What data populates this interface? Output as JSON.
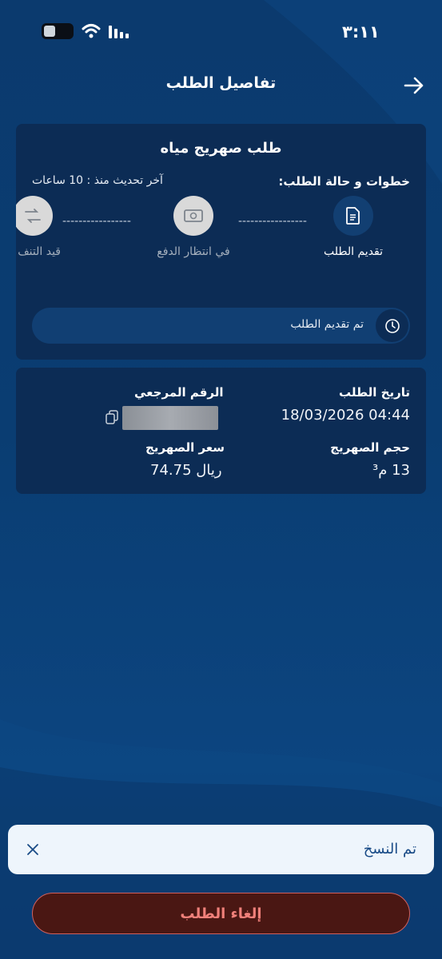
{
  "status_bar": {
    "time": "٣:١١",
    "icons": [
      "battery-icon",
      "wifi-icon",
      "signal-icon"
    ]
  },
  "header": {
    "title": "تفاصيل الطلب",
    "back_icon": "arrow-right-icon"
  },
  "request": {
    "service_title": "طلب صهريج مياه",
    "steps_heading": "خطوات و حالة الطلب:",
    "last_update": "آخر تحديث منذ :  10 ساعات",
    "steps": [
      {
        "label": "تقديم الطلب",
        "icon": "document-icon",
        "state": "active"
      },
      {
        "label": "في انتظار الدفع",
        "icon": "cash-icon",
        "state": "pending"
      },
      {
        "label": "قيد التنف",
        "icon": "route-icon",
        "state": "pending"
      }
    ],
    "dash_line": "-----------------",
    "status_text": "تم تقديم الطلب",
    "status_icon": "clock-icon"
  },
  "details": {
    "order_date_label": "تاريخ الطلب",
    "order_date_value": "18/03/2026 04:44",
    "reference_label": "الرقم المرجعي",
    "tank_size_label": "حجم الصهريج",
    "tank_size_value": "13 م³",
    "tank_price_label": "سعر الصهريج",
    "tank_price_value": "ريال 74.75"
  },
  "toast": {
    "message": "تم النسخ"
  },
  "actions": {
    "cancel_label": "إلغاء الطلب"
  },
  "colors": {
    "background": "#0b3a6e",
    "card": "#0c2c55",
    "cancel_border": "#d1605c",
    "cancel_text": "#f0807a",
    "toast_bg": "#eef5fc"
  }
}
